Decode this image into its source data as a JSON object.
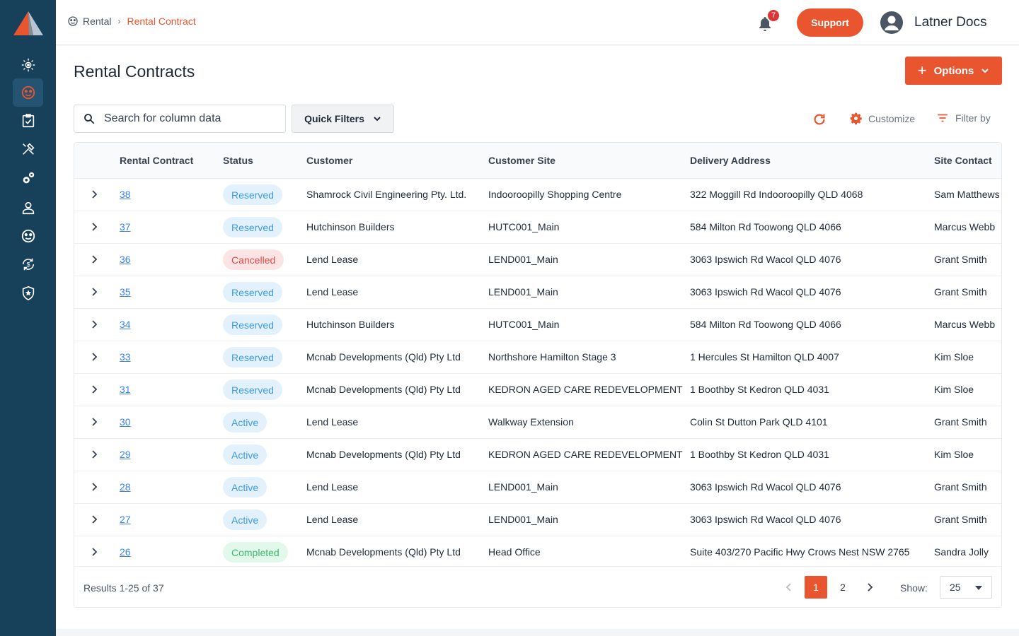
{
  "colors": {
    "accent": "#e8552e",
    "sidebar": "#17405a",
    "link": "#3b82f6"
  },
  "sidebar": {
    "items": [
      {
        "icon": "sun-dashboard-icon"
      },
      {
        "icon": "rental-icon",
        "active": true
      },
      {
        "icon": "clipboard-check-icon"
      },
      {
        "icon": "tools-icon"
      },
      {
        "icon": "gears-icon"
      },
      {
        "icon": "user-icon"
      },
      {
        "icon": "palette-icon"
      },
      {
        "icon": "currency-refresh-icon"
      },
      {
        "icon": "shield-star-icon"
      }
    ]
  },
  "header": {
    "breadcrumb": {
      "root": "Rental",
      "current": "Rental Contract"
    },
    "notifications_count": "7",
    "support_label": "Support",
    "user_name": "Latner Docs"
  },
  "page": {
    "title": "Rental Contracts",
    "options_label": "Options"
  },
  "toolbar": {
    "search_placeholder": "Search for column data",
    "quick_filters_label": "Quick Filters",
    "customize_label": "Customize",
    "filter_by_label": "Filter by"
  },
  "table": {
    "columns": [
      "Rental Contract",
      "Status",
      "Customer",
      "Customer Site",
      "Delivery Address",
      "Site Contact"
    ],
    "rows": [
      {
        "id": "38",
        "status": "Reserved",
        "customer": "Shamrock Civil Engineering Pty. Ltd.",
        "site": "Indooroopilly Shopping Centre",
        "address": "322 Moggill Rd Indooroopilly QLD 4068",
        "contact": "Sam Matthews"
      },
      {
        "id": "37",
        "status": "Reserved",
        "customer": "Hutchinson Builders",
        "site": "HUTC001_Main",
        "address": "584 Milton Rd Toowong QLD 4066",
        "contact": "Marcus Webb"
      },
      {
        "id": "36",
        "status": "Cancelled",
        "customer": "Lend Lease",
        "site": "LEND001_Main",
        "address": "3063 Ipswich Rd Wacol QLD 4076",
        "contact": "Grant Smith"
      },
      {
        "id": "35",
        "status": "Reserved",
        "customer": "Lend Lease",
        "site": "LEND001_Main",
        "address": "3063 Ipswich Rd Wacol QLD 4076",
        "contact": "Grant Smith"
      },
      {
        "id": "34",
        "status": "Reserved",
        "customer": "Hutchinson Builders",
        "site": "HUTC001_Main",
        "address": "584 Milton Rd Toowong QLD 4066",
        "contact": "Marcus Webb"
      },
      {
        "id": "33",
        "status": "Reserved",
        "customer": "Mcnab Developments (Qld) Pty Ltd",
        "site": "Northshore Hamilton Stage 3",
        "address": "1 Hercules St Hamilton QLD 4007",
        "contact": "Kim Sloe"
      },
      {
        "id": "31",
        "status": "Reserved",
        "customer": "Mcnab Developments (Qld) Pty Ltd",
        "site": "KEDRON AGED CARE REDEVELOPMENT",
        "address": "1 Boothby St Kedron QLD 4031",
        "contact": "Kim Sloe"
      },
      {
        "id": "30",
        "status": "Active",
        "customer": "Lend Lease",
        "site": "Walkway Extension",
        "address": "Colin St Dutton Park QLD 4101",
        "contact": "Grant Smith"
      },
      {
        "id": "29",
        "status": "Active",
        "customer": "Mcnab Developments (Qld) Pty Ltd",
        "site": "KEDRON AGED CARE REDEVELOPMENT",
        "address": "1 Boothby St Kedron QLD 4031",
        "contact": "Kim Sloe"
      },
      {
        "id": "28",
        "status": "Active",
        "customer": "Lend Lease",
        "site": "LEND001_Main",
        "address": "3063 Ipswich Rd Wacol QLD 4076",
        "contact": "Grant Smith"
      },
      {
        "id": "27",
        "status": "Active",
        "customer": "Lend Lease",
        "site": "LEND001_Main",
        "address": "3063 Ipswich Rd Wacol QLD 4076",
        "contact": "Grant Smith"
      },
      {
        "id": "26",
        "status": "Completed",
        "customer": "Mcnab Developments (Qld) Pty Ltd",
        "site": "Head Office",
        "address": "Suite 403/270 Pacific Hwy Crows Nest NSW 2765",
        "contact": "Sandra Jolly"
      }
    ]
  },
  "footer": {
    "results_text": "Results 1-25 of 37",
    "pages": [
      "1",
      "2"
    ],
    "current_page": "1",
    "show_label": "Show:",
    "page_size": "25"
  }
}
